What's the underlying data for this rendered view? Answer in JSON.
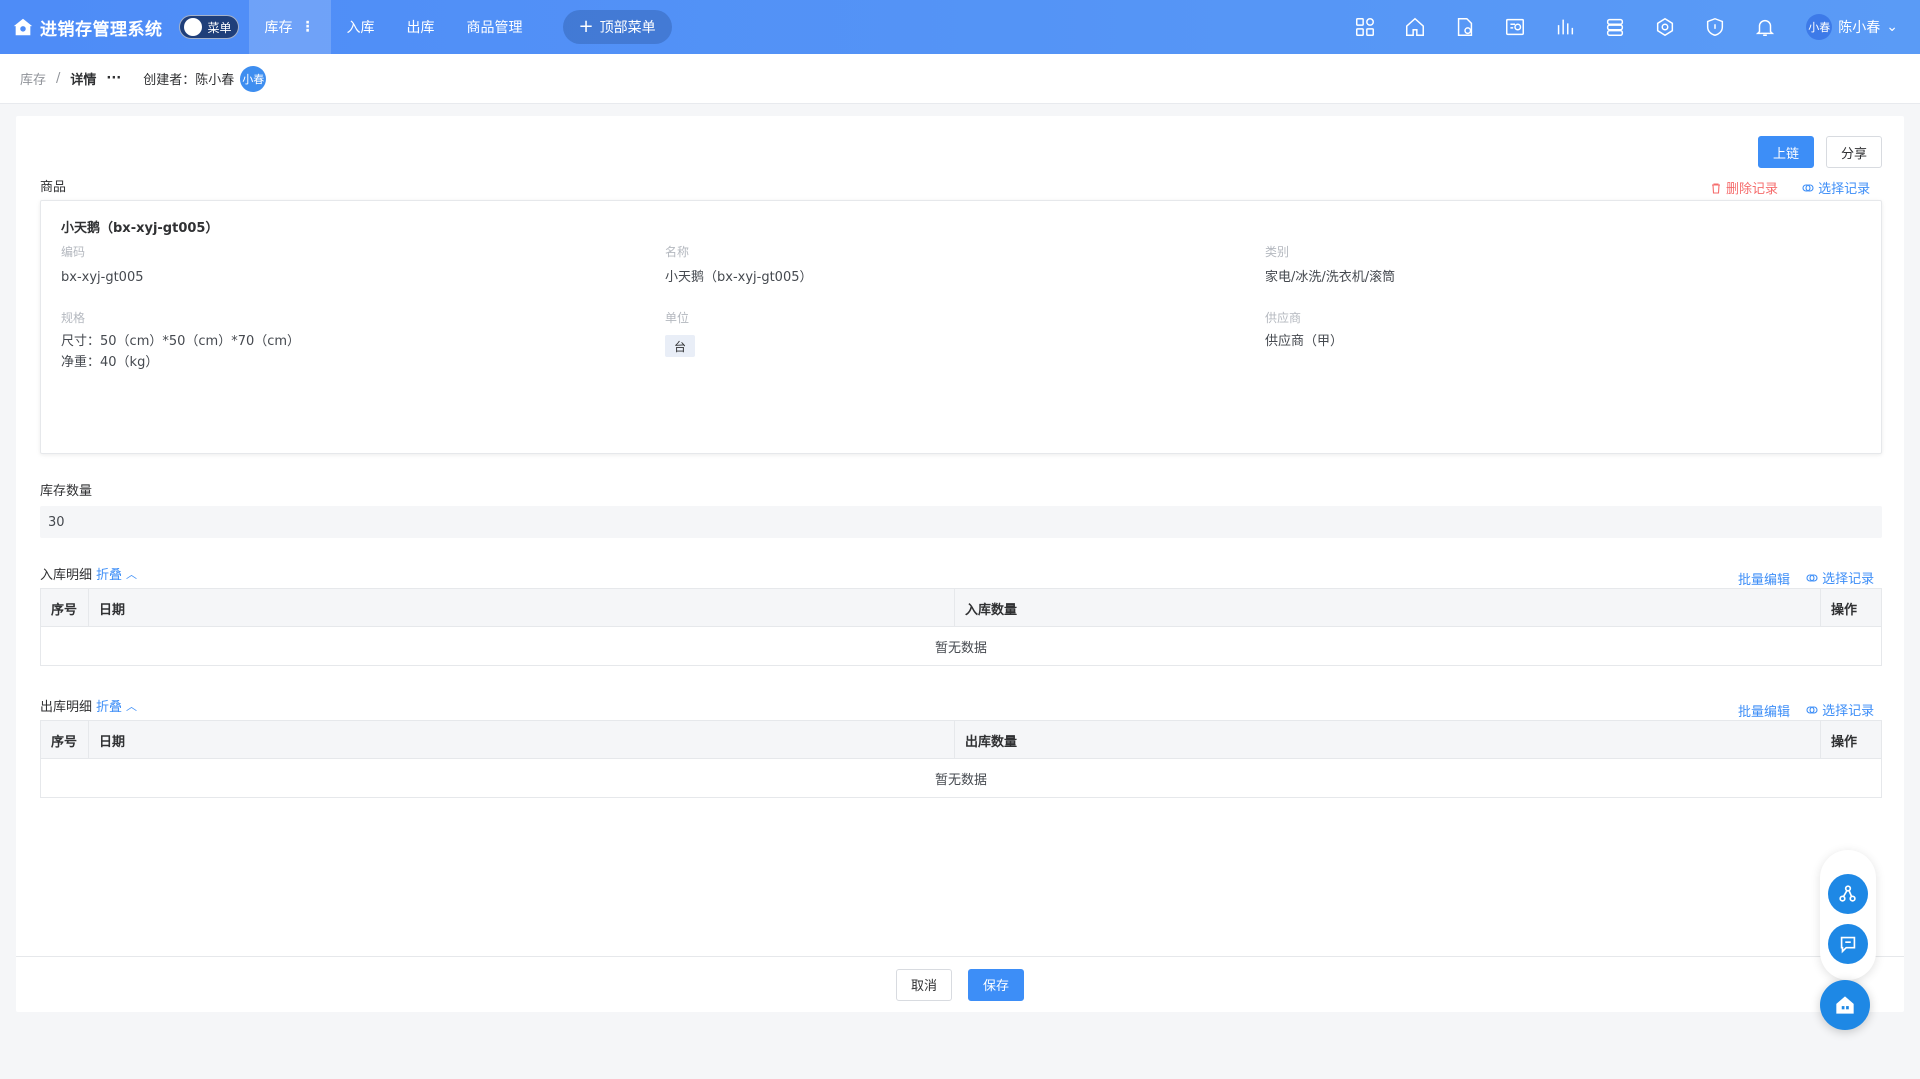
{
  "app": {
    "title": "进销存管理系统",
    "menu_toggle_label": "菜单"
  },
  "nav": {
    "items": [
      {
        "label": "库存",
        "active": true
      },
      {
        "label": "入库"
      },
      {
        "label": "出库"
      },
      {
        "label": "商品管理"
      }
    ],
    "top_menu_label": "顶部菜单"
  },
  "header_icons": [
    "apps-icon",
    "home-icon",
    "document-icon",
    "report-icon",
    "chart-icon",
    "server-icon",
    "settings-network-icon",
    "shield-icon",
    "bell-icon"
  ],
  "user": {
    "avatar_text": "小春",
    "name": "陈小春"
  },
  "breadcrumb": {
    "parent": "库存",
    "separator": "/",
    "current": "详情",
    "more": "···",
    "creator_label": "创建者：",
    "creator_name": "陈小春",
    "creator_avatar": "小春"
  },
  "actions": {
    "chain": "上链",
    "share": "分享"
  },
  "goods": {
    "section_title": "商品",
    "delete_record": "删除记录",
    "select_record": "选择记录",
    "name": "小天鹅（bx-xyj-gt005）",
    "fields": {
      "code_label": "编码",
      "code_value": "bx-xyj-gt005",
      "name_label": "名称",
      "name_value": "小天鹅（bx-xyj-gt005）",
      "category_label": "类别",
      "category_value": "家电/冰洗/洗衣机/滚筒",
      "spec_label": "规格",
      "spec_line1": "尺寸：50（cm）*50（cm）*70（cm）",
      "spec_line2": "净重：40（kg）",
      "unit_label": "单位",
      "unit_value": "台",
      "supplier_label": "供应商",
      "supplier_value": "供应商（甲）"
    }
  },
  "stock": {
    "label": "库存数量",
    "value": "30"
  },
  "inbound": {
    "title": "入库明细",
    "collapse": "折叠",
    "batch_edit": "批量编辑",
    "select_record": "选择记录",
    "columns": [
      "序号",
      "日期",
      "入库数量",
      "操作"
    ],
    "empty": "暂无数据"
  },
  "outbound": {
    "title": "出库明细",
    "collapse": "折叠",
    "batch_edit": "批量编辑",
    "select_record": "选择记录",
    "columns": [
      "序号",
      "日期",
      "出库数量",
      "操作"
    ],
    "empty": "暂无数据"
  },
  "footer": {
    "cancel": "取消",
    "save": "保存"
  },
  "colors": {
    "primary": "#3d8ef7",
    "topbar": "#4e8cf7",
    "danger": "#f56c6c",
    "fab": "#1e88e5"
  }
}
